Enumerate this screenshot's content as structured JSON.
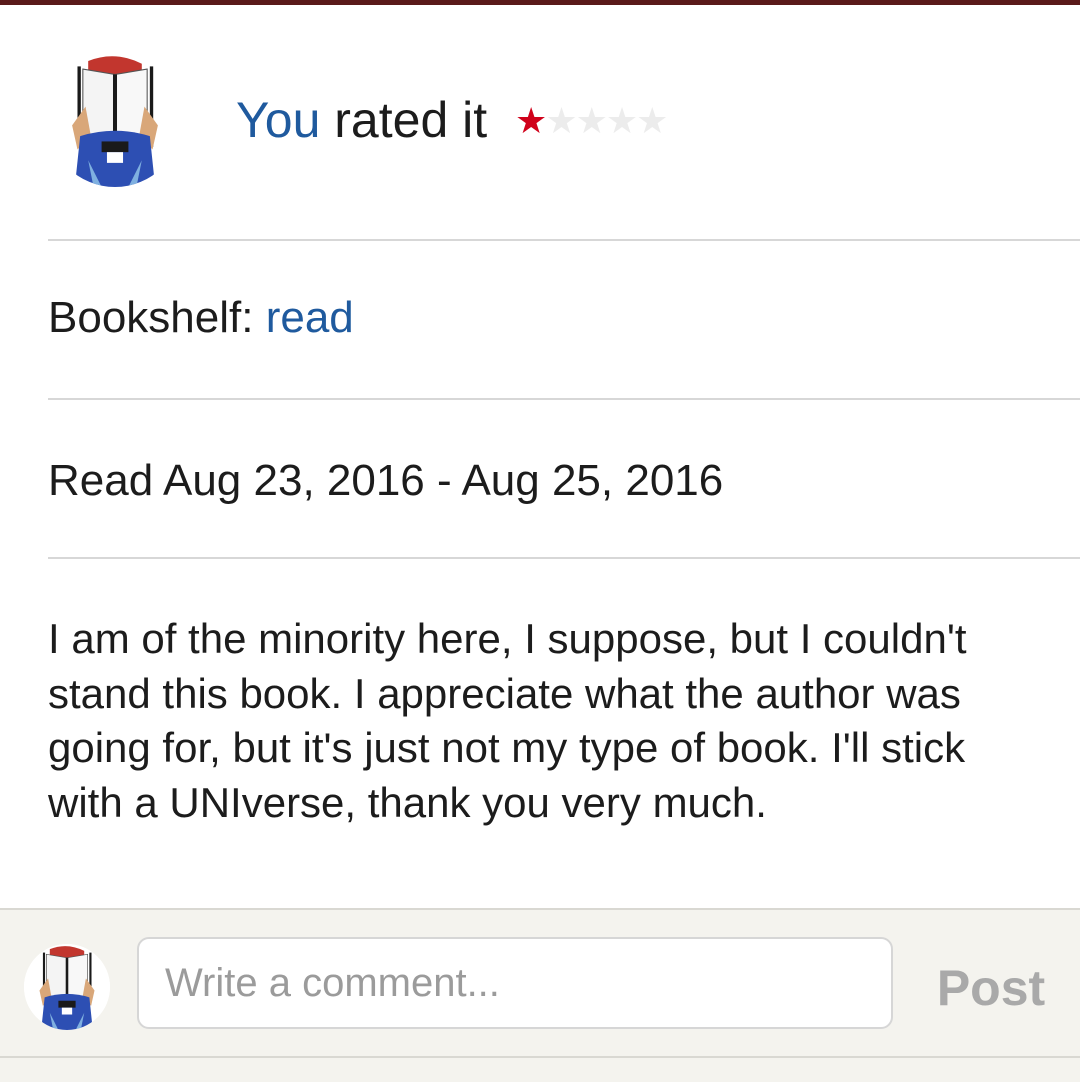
{
  "rating": {
    "you_label": "You",
    "rated_label": "rated it",
    "stars": [
      "★",
      "★",
      "★",
      "★",
      "★"
    ],
    "filled_count": 1,
    "filled_color": "#d0021b",
    "empty_color": "#ececec"
  },
  "shelf": {
    "label": "Bookshelf:",
    "value": "read"
  },
  "read_dates": {
    "text": "Read Aug 23, 2016 - Aug 25, 2016"
  },
  "review": {
    "text": "I am of the minority here, I suppose, but I couldn't stand this book. I appreciate what the author was going for, but it's just not my type of book. I'll stick with a UNIverse, thank you very much."
  },
  "comment": {
    "placeholder": "Write a comment...",
    "post_label": "Post"
  },
  "colors": {
    "link": "#1f5a9e",
    "top_bar": "#5a1a1a",
    "comment_bar_bg": "#f4f3ee"
  },
  "icons": {
    "avatar": "user-avatar-reading-book"
  }
}
